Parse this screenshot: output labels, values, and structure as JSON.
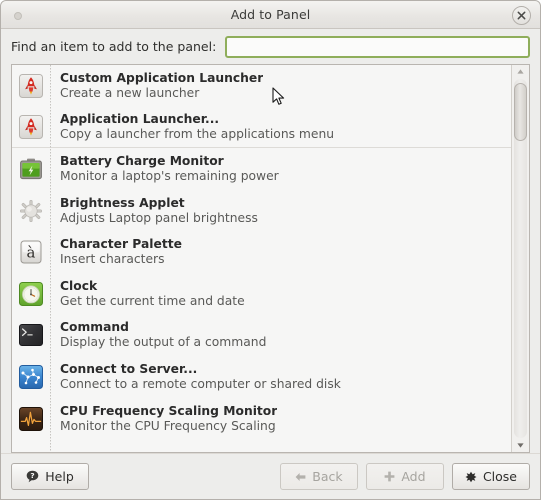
{
  "window": {
    "title": "Add to Panel",
    "close_label": "×"
  },
  "search": {
    "label": "Find an item to add to the panel:",
    "value": "",
    "placeholder": ""
  },
  "list": {
    "items": [
      {
        "icon": "application-launcher-icon",
        "title": "Custom Application Launcher",
        "desc": "Create a new launcher"
      },
      {
        "icon": "application-launcher-icon",
        "title": "Application Launcher...",
        "desc": "Copy a launcher from the applications menu"
      },
      {
        "icon": "battery-icon",
        "title": "Battery Charge Monitor",
        "desc": "Monitor a laptop's remaining power"
      },
      {
        "icon": "brightness-icon",
        "title": "Brightness Applet",
        "desc": "Adjusts Laptop panel brightness"
      },
      {
        "icon": "character-palette-icon",
        "title": "Character Palette",
        "desc": "Insert characters"
      },
      {
        "icon": "clock-icon",
        "title": "Clock",
        "desc": "Get the current time and date"
      },
      {
        "icon": "terminal-icon",
        "title": "Command",
        "desc": "Display the output of a command"
      },
      {
        "icon": "network-server-icon",
        "title": "Connect to Server...",
        "desc": "Connect to a remote computer or shared disk"
      },
      {
        "icon": "cpu-frequency-icon",
        "title": "CPU Frequency Scaling Monitor",
        "desc": "Monitor the CPU Frequency Scaling"
      }
    ]
  },
  "scrollbar": {
    "up_arrow": "▲",
    "down_arrow": "▼"
  },
  "actions": {
    "help_label": "Help",
    "back_label": "Back",
    "add_label": "Add",
    "close_label": "Close"
  },
  "colors": {
    "focus_green": "#8fae5b",
    "window_bg": "#ededeb",
    "list_bg": "#f6f6f5",
    "title_text": "#2b2b2b",
    "desc_text": "#595957"
  }
}
